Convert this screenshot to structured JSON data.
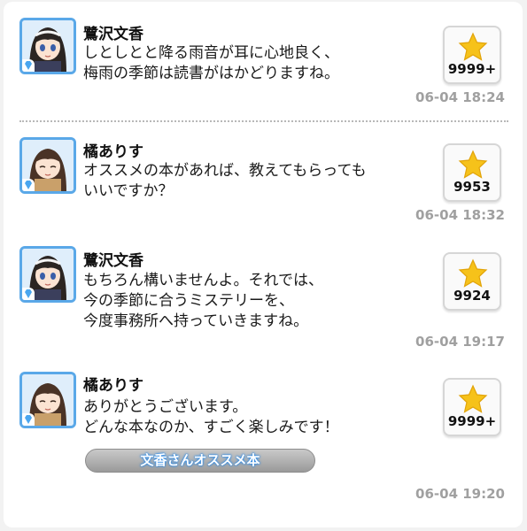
{
  "posts": [
    {
      "name": "鷺沢文香",
      "text": "しとしとと降る雨音が耳に心地良く、\n梅雨の季節は読書がはかどりますね。",
      "likes": "9999+",
      "time": "06-04 18:24",
      "avatar": "fumika"
    },
    {
      "name": "橘ありす",
      "text": "オススメの本があれば、教えてもらっても\nいいですか？",
      "likes": "9953",
      "time": "06-04 18:32",
      "avatar": "arisu"
    },
    {
      "name": "鷺沢文香",
      "text": "もちろん構いませんよ。それでは、\n今の季節に合うミステリーを、\n今度事務所へ持っていきますね。",
      "likes": "9924",
      "time": "06-04 19:17",
      "avatar": "fumika"
    },
    {
      "name": "橘ありす",
      "text": "ありがとうございます。\nどんな本なのか、すごく楽しみです！",
      "likes": "9999+",
      "time": "06-04 19:20",
      "avatar": "arisu"
    }
  ],
  "tag": {
    "label": "文香さんオススメ本"
  },
  "colors": {
    "accent": "#5aa8e8",
    "star": "#f6c21a",
    "time": "#a0a0a0"
  },
  "icons": {
    "like": "star-icon",
    "badge": "diamond-icon"
  }
}
